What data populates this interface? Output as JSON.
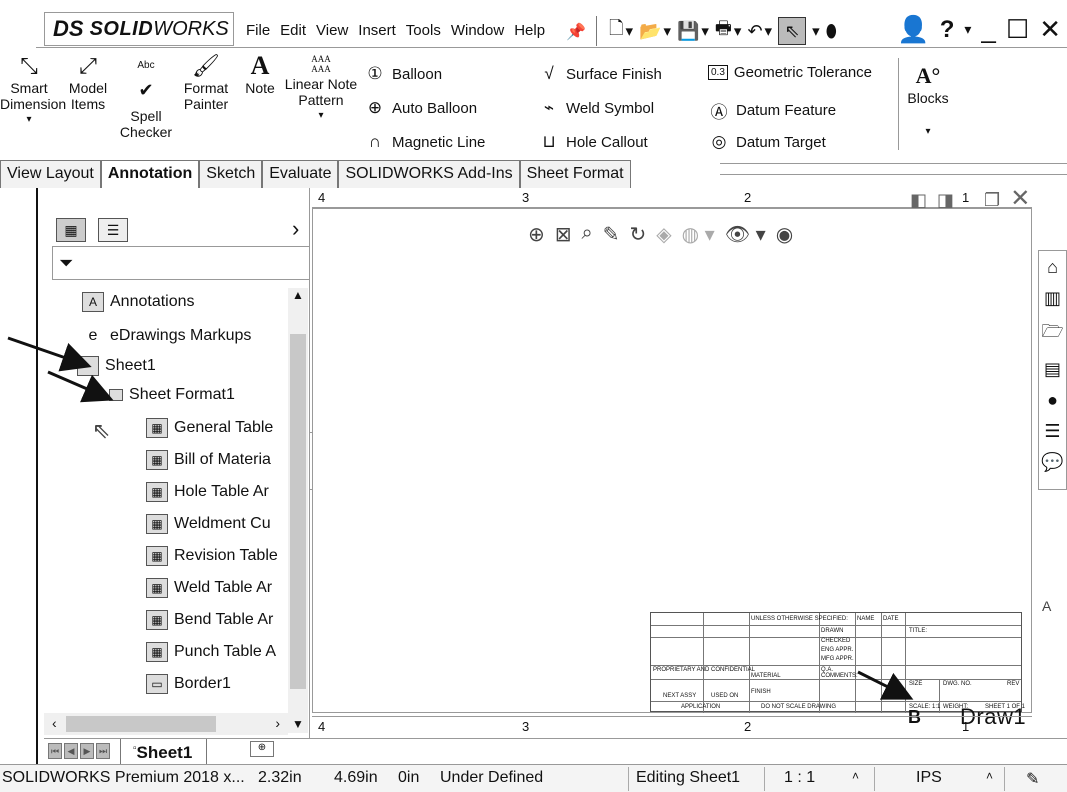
{
  "titlebar": {
    "logo_ds": "DS",
    "logo_solid": "SOLID",
    "logo_works": "WORKS",
    "menu": [
      "File",
      "Edit",
      "View",
      "Insert",
      "Tools",
      "Window",
      "Help"
    ],
    "help_glyph": "?"
  },
  "ribbon": {
    "smart_dimension": "Smart Dimension",
    "model_items": "Model Items",
    "spell_checker": "Spell Checker",
    "format_painter": "Format Painter",
    "note": "Note",
    "linear_note_pattern": "Linear Note Pattern",
    "balloon": "Balloon",
    "auto_balloon": "Auto Balloon",
    "magnetic_line": "Magnetic Line",
    "surface_finish": "Surface Finish",
    "weld_symbol": "Weld Symbol",
    "hole_callout": "Hole Callout",
    "geometric_tolerance": "Geometric Tolerance",
    "geometric_tolerance_icon_text": "0.3",
    "datum_feature": "Datum Feature",
    "datum_target": "Datum Target",
    "blocks": "Blocks",
    "abc_label": "Abc",
    "aaa_label": "AAA"
  },
  "tabs": [
    {
      "label": "View Layout",
      "active": false
    },
    {
      "label": "Annotation",
      "active": true
    },
    {
      "label": "Sketch",
      "active": false
    },
    {
      "label": "Evaluate",
      "active": false
    },
    {
      "label": "SOLIDWORKS Add-Ins",
      "active": false
    },
    {
      "label": "Sheet Format",
      "active": false
    }
  ],
  "tree": {
    "items": [
      {
        "label": "Annotations",
        "icon": "annotations-icon"
      },
      {
        "label": "eDrawings Markups",
        "icon": "edrawings-icon"
      },
      {
        "label": "Sheet1",
        "icon": "sheet-icon"
      },
      {
        "label": "Sheet Format1",
        "icon": "sheet-format-icon"
      },
      {
        "label": "General Table",
        "icon": "general-table-icon"
      },
      {
        "label": "Bill of Materia",
        "icon": "bom-icon"
      },
      {
        "label": "Hole Table Ar",
        "icon": "hole-table-icon"
      },
      {
        "label": "Weldment Cu",
        "icon": "weldment-icon"
      },
      {
        "label": "Revision Table",
        "icon": "revision-table-icon"
      },
      {
        "label": "Weld Table Ar",
        "icon": "weld-table-icon"
      },
      {
        "label": "Bend Table Ar",
        "icon": "bend-table-icon"
      },
      {
        "label": "Punch Table A",
        "icon": "punch-table-icon"
      },
      {
        "label": "Border1",
        "icon": "border-icon"
      }
    ]
  },
  "zones": {
    "top": [
      "4",
      "3",
      "2",
      "1"
    ],
    "bottom": [
      "4",
      "3",
      "2",
      "1"
    ],
    "right_letter": "A"
  },
  "title_block": {
    "size": "B",
    "dwg_no_label": "DWG. NO.",
    "dwg_no": "Draw1",
    "rev_label": "REV",
    "scale": "SCALE: 1:1",
    "weight_label": "WEIGHT:",
    "sheet": "SHEET 1 OF 1",
    "title_label": "TITLE:",
    "size_label": "SIZE",
    "drawn": "DRAWN",
    "checked": "CHECKED",
    "eng_appr": "ENG APPR.",
    "mfg_appr": "MFG APPR.",
    "qa": "Q.A.",
    "comments": "COMMENTS:",
    "name_col": "NAME",
    "date_col": "DATE",
    "unless": "UNLESS OTHERWISE SPECIFIED:",
    "material": "MATERIAL",
    "finish": "FINISH",
    "next_assy": "NEXT ASSY",
    "used_on": "USED ON",
    "application": "APPLICATION",
    "do_not_scale": "DO NOT SCALE DRAWING",
    "proprietary": "PROPRIETARY AND CONFIDENTIAL"
  },
  "sheet_tabs": {
    "active": "Sheet1"
  },
  "status": {
    "product": "SOLIDWORKS Premium 2018 x...",
    "x": "2.32in",
    "y": "4.69in",
    "z": "0in",
    "state": "Under Defined",
    "editing": "Editing Sheet1",
    "scale": "1 : 1",
    "units": "IPS"
  }
}
